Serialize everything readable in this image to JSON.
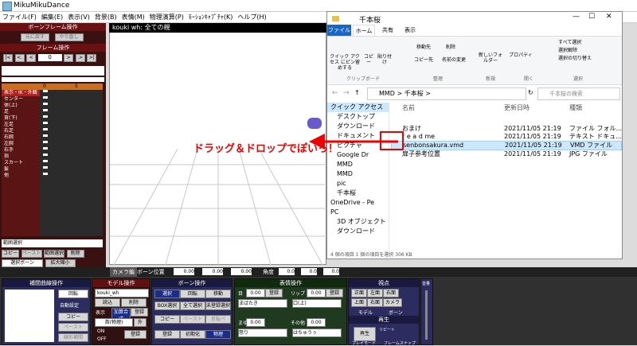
{
  "app": {
    "title": "MikuMikuDance"
  },
  "menu": [
    "ファイル(F)",
    "編集(E)",
    "表示(V)",
    "背景(B)",
    "表情(M)",
    "物理演算(P)",
    "ﾓｰｼｮﾝｷｬﾌﾟﾁｬ(K)",
    "ヘルプ(H)"
  ],
  "left_panel": {
    "bone_frame_title": "ボーンフレーム操作",
    "btn_restore": "元に戻す",
    "btn_redo": "やり直し",
    "frame_op_title": "フレーム操作",
    "frame_value": "0",
    "nav_buttons": [
      "|<",
      "<.",
      "<",
      ">",
      ".>",
      ">|"
    ],
    "rows": [
      "表示・IK・外観",
      "センター",
      "体(上)",
      "足",
      "首(下)",
      "左足",
      "右足",
      "右腕",
      "左腕",
      "右手",
      "指",
      "スカート",
      "髪",
      "他"
    ],
    "col_marks": [
      "0",
      "5"
    ],
    "bottom_label": "範囲選択",
    "btn_frame": "フレーム",
    "btn_copy": "コピー",
    "btn_paste": "ペースト",
    "btn_delete": "削除",
    "btn_scope_select": "範囲選択",
    "btn_select_bone": "選択ボーン",
    "btn_expand": "拡大縮小"
  },
  "viewport": {
    "header": "kouki wh: 全ての親"
  },
  "annotation": "ドラッグ＆ドロップでぽいっ！",
  "explorer": {
    "title": "千本桜",
    "tabs": [
      "ファイル",
      "ホーム",
      "共有",
      "表示"
    ],
    "ribbon": {
      "group_clipboard": "クリップボード",
      "group_organize": "整理",
      "group_new": "新規",
      "group_open": "開く",
      "group_select": "選択",
      "pin": "クイック アクセス にピン留めする",
      "copy": "コピー",
      "paste": "貼り付け",
      "move": "移動先",
      "delete": "削除",
      "copyto": "コピー先",
      "rename": "名前の変更",
      "new_folder": "新しいフォルダー",
      "properties": "プロパティ",
      "select_all": "すべて選択",
      "select_none": "選択解除",
      "invert": "選択の切り替え"
    },
    "breadcrumb": [
      "MMD",
      "千本桜"
    ],
    "search_placeholder": "千本桜の検索",
    "nav_items": [
      "クイック アクセス",
      "デスクトップ",
      "ダウンロード",
      "ドキュメント",
      "ピクチャ",
      "Google Dr",
      "MMD",
      "MMD",
      "pic",
      "千本桜",
      "OneDrive - Pe",
      "PC",
      "3D オブジェクト",
      "ダウンロード"
    ],
    "columns": {
      "name": "名前",
      "date": "更新日時",
      "type": "種類"
    },
    "files": [
      {
        "name": "おまけ",
        "date": "2021/11/05 21:19",
        "type": "ファイル フォル..."
      },
      {
        "name": "r e a d me",
        "date": "2021/11/05 21:19",
        "type": "テキスト ドキュ..."
      },
      {
        "name": "senbonsakura.vmd",
        "date": "2021/11/05 21:19",
        "type": "VMD ファイル"
      },
      {
        "name": "扉子参考位置",
        "date": "2021/11/05 21:19",
        "type": "JPG ファイル"
      }
    ],
    "status": "4 個の項目   1 個の項目を選択  306 KB"
  },
  "bottom": {
    "camera_mode": "カメラ編",
    "bone_pos_label": "ボーン位置",
    "angle_label": "角度",
    "pos_values": [
      "0.00",
      "0.00",
      "0.00"
    ],
    "angle_values": [
      "0.0",
      "0.0",
      "0.0"
    ],
    "interp_title": "補間曲線操作",
    "interp_rotate": "回転",
    "interp_auto": "自動設定",
    "interp_copy": "コピー",
    "interp_paste": "ペースト",
    "interp_linear": "線形補間",
    "model_title": "モデル操作",
    "model_name": "kouki_wh",
    "model_btn_load": "読込",
    "model_btn_delete": "削除",
    "model_display": "表示",
    "model_addsyn": "加算合成",
    "model_register": "登録",
    "model_other": "外",
    "model_bone": "首(物理)",
    "on_label": "ON",
    "off_label": "OFF",
    "bone_title": "ボーン操作",
    "bone_btns": [
      "選択",
      "回転",
      "移動",
      "BOX選択",
      "全て選択",
      "未登録選択",
      "コピー",
      "ペースト",
      "反転ペ",
      "登録",
      "初期化",
      "物理"
    ],
    "face_title": "表情操作",
    "face_rows": [
      "目",
      "リップ",
      "まゆ",
      "その他"
    ],
    "face_values": [
      "0.00",
      "0.00",
      "0.00",
      "0.00"
    ],
    "face_sel": [
      "まばたき",
      "口(上)",
      "怒り",
      "はちゅうぅ"
    ],
    "face_btn_reg": "登録",
    "view_title": "視点",
    "view_btns": [
      "正面",
      "左面",
      "右面",
      "上面",
      "右面",
      "左面",
      "カメラ"
    ],
    "view_model": "モデル",
    "view_bone": "ボーン",
    "play_title": "再生",
    "play_btn": "再生",
    "play_loop": "リピート",
    "play_vol": "音量",
    "play_from": "プレイモード",
    "play_to": "フレームスナップ"
  }
}
